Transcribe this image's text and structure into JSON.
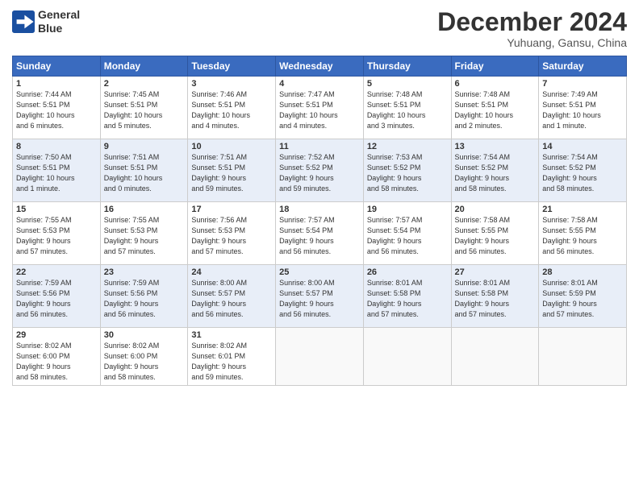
{
  "header": {
    "logo_line1": "General",
    "logo_line2": "Blue",
    "month": "December 2024",
    "location": "Yuhuang, Gansu, China"
  },
  "weekdays": [
    "Sunday",
    "Monday",
    "Tuesday",
    "Wednesday",
    "Thursday",
    "Friday",
    "Saturday"
  ],
  "weeks": [
    [
      {
        "day": "1",
        "info": "Sunrise: 7:44 AM\nSunset: 5:51 PM\nDaylight: 10 hours\nand 6 minutes."
      },
      {
        "day": "2",
        "info": "Sunrise: 7:45 AM\nSunset: 5:51 PM\nDaylight: 10 hours\nand 5 minutes."
      },
      {
        "day": "3",
        "info": "Sunrise: 7:46 AM\nSunset: 5:51 PM\nDaylight: 10 hours\nand 4 minutes."
      },
      {
        "day": "4",
        "info": "Sunrise: 7:47 AM\nSunset: 5:51 PM\nDaylight: 10 hours\nand 4 minutes."
      },
      {
        "day": "5",
        "info": "Sunrise: 7:48 AM\nSunset: 5:51 PM\nDaylight: 10 hours\nand 3 minutes."
      },
      {
        "day": "6",
        "info": "Sunrise: 7:48 AM\nSunset: 5:51 PM\nDaylight: 10 hours\nand 2 minutes."
      },
      {
        "day": "7",
        "info": "Sunrise: 7:49 AM\nSunset: 5:51 PM\nDaylight: 10 hours\nand 1 minute."
      }
    ],
    [
      {
        "day": "8",
        "info": "Sunrise: 7:50 AM\nSunset: 5:51 PM\nDaylight: 10 hours\nand 1 minute."
      },
      {
        "day": "9",
        "info": "Sunrise: 7:51 AM\nSunset: 5:51 PM\nDaylight: 10 hours\nand 0 minutes."
      },
      {
        "day": "10",
        "info": "Sunrise: 7:51 AM\nSunset: 5:51 PM\nDaylight: 9 hours\nand 59 minutes."
      },
      {
        "day": "11",
        "info": "Sunrise: 7:52 AM\nSunset: 5:52 PM\nDaylight: 9 hours\nand 59 minutes."
      },
      {
        "day": "12",
        "info": "Sunrise: 7:53 AM\nSunset: 5:52 PM\nDaylight: 9 hours\nand 58 minutes."
      },
      {
        "day": "13",
        "info": "Sunrise: 7:54 AM\nSunset: 5:52 PM\nDaylight: 9 hours\nand 58 minutes."
      },
      {
        "day": "14",
        "info": "Sunrise: 7:54 AM\nSunset: 5:52 PM\nDaylight: 9 hours\nand 58 minutes."
      }
    ],
    [
      {
        "day": "15",
        "info": "Sunrise: 7:55 AM\nSunset: 5:53 PM\nDaylight: 9 hours\nand 57 minutes."
      },
      {
        "day": "16",
        "info": "Sunrise: 7:55 AM\nSunset: 5:53 PM\nDaylight: 9 hours\nand 57 minutes."
      },
      {
        "day": "17",
        "info": "Sunrise: 7:56 AM\nSunset: 5:53 PM\nDaylight: 9 hours\nand 57 minutes."
      },
      {
        "day": "18",
        "info": "Sunrise: 7:57 AM\nSunset: 5:54 PM\nDaylight: 9 hours\nand 56 minutes."
      },
      {
        "day": "19",
        "info": "Sunrise: 7:57 AM\nSunset: 5:54 PM\nDaylight: 9 hours\nand 56 minutes."
      },
      {
        "day": "20",
        "info": "Sunrise: 7:58 AM\nSunset: 5:55 PM\nDaylight: 9 hours\nand 56 minutes."
      },
      {
        "day": "21",
        "info": "Sunrise: 7:58 AM\nSunset: 5:55 PM\nDaylight: 9 hours\nand 56 minutes."
      }
    ],
    [
      {
        "day": "22",
        "info": "Sunrise: 7:59 AM\nSunset: 5:56 PM\nDaylight: 9 hours\nand 56 minutes."
      },
      {
        "day": "23",
        "info": "Sunrise: 7:59 AM\nSunset: 5:56 PM\nDaylight: 9 hours\nand 56 minutes."
      },
      {
        "day": "24",
        "info": "Sunrise: 8:00 AM\nSunset: 5:57 PM\nDaylight: 9 hours\nand 56 minutes."
      },
      {
        "day": "25",
        "info": "Sunrise: 8:00 AM\nSunset: 5:57 PM\nDaylight: 9 hours\nand 56 minutes."
      },
      {
        "day": "26",
        "info": "Sunrise: 8:01 AM\nSunset: 5:58 PM\nDaylight: 9 hours\nand 57 minutes."
      },
      {
        "day": "27",
        "info": "Sunrise: 8:01 AM\nSunset: 5:58 PM\nDaylight: 9 hours\nand 57 minutes."
      },
      {
        "day": "28",
        "info": "Sunrise: 8:01 AM\nSunset: 5:59 PM\nDaylight: 9 hours\nand 57 minutes."
      }
    ],
    [
      {
        "day": "29",
        "info": "Sunrise: 8:02 AM\nSunset: 6:00 PM\nDaylight: 9 hours\nand 58 minutes."
      },
      {
        "day": "30",
        "info": "Sunrise: 8:02 AM\nSunset: 6:00 PM\nDaylight: 9 hours\nand 58 minutes."
      },
      {
        "day": "31",
        "info": "Sunrise: 8:02 AM\nSunset: 6:01 PM\nDaylight: 9 hours\nand 59 minutes."
      },
      {
        "day": "",
        "info": ""
      },
      {
        "day": "",
        "info": ""
      },
      {
        "day": "",
        "info": ""
      },
      {
        "day": "",
        "info": ""
      }
    ]
  ]
}
